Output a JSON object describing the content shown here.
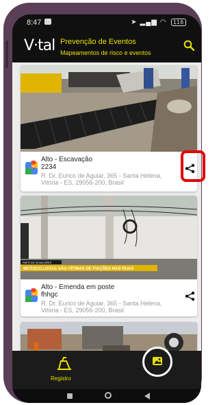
{
  "status_bar": {
    "time": "8:47",
    "battery": "116"
  },
  "app_bar": {
    "logo": "V·tal",
    "title": "Prevenção de Eventos",
    "subtitle": "Mapeamentos de risco e eventos"
  },
  "cards": [
    {
      "title": "Alto - Escavação",
      "id": "2234",
      "address": "R. Dr. Eurico de Aguiar, 365 - Santa Helena, Vitória - ES, 29056-200, Brasil"
    },
    {
      "title": "Alto - Emenda em poste",
      "id": "fhhgc",
      "address": "R. Dr. Eurico de Aguiar, 365 - Santa Helena, Vitória - ES, 29056-200, Brasil",
      "photo_caption_small": "PAPO DE 30 MILHÕES",
      "photo_caption": "MOTOCICLISTAS SÃO VÍTIMAS DE FIAÇÕES NAS RUAS"
    }
  ],
  "bottom_nav": {
    "register_label": "Registro"
  },
  "colors": {
    "accent": "#e8e200",
    "highlight": "#e00000",
    "frame": "#5b3f57"
  }
}
